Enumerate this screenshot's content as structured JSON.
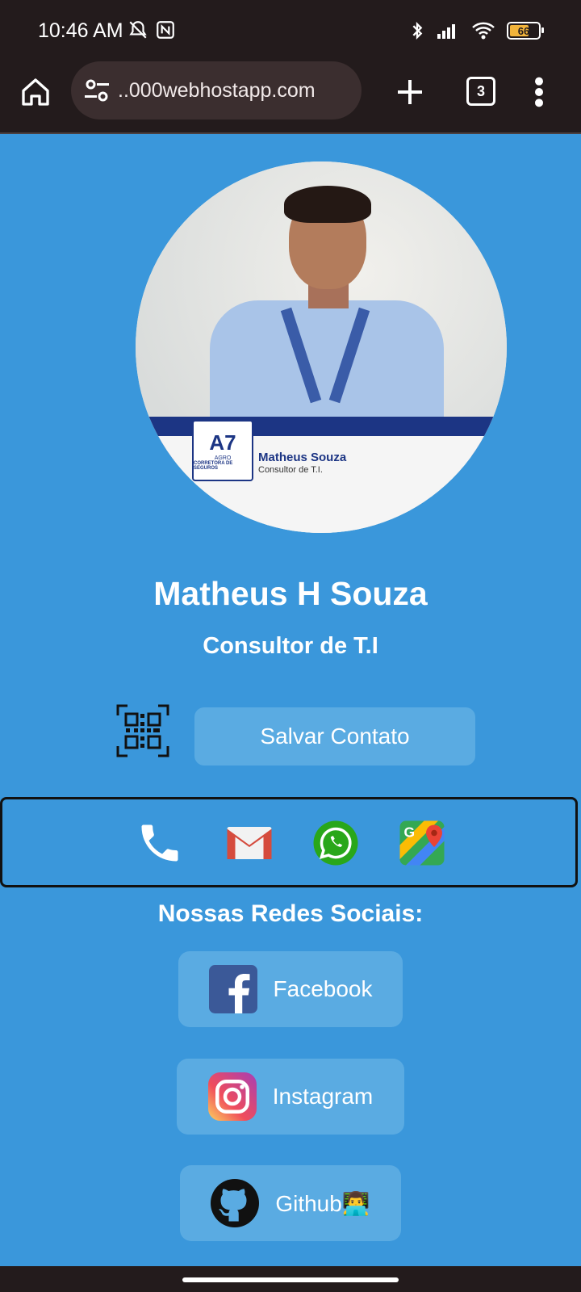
{
  "status_bar": {
    "time": "10:46 AM",
    "battery": "66"
  },
  "browser": {
    "url": "..000webhostapp.com",
    "tab_count": "3"
  },
  "profile": {
    "photo_badge_name": "Matheus Souza",
    "photo_badge_role": "Consultor de T.I.",
    "photo_logo_text": "A7",
    "photo_logo_sub": "AGRO",
    "photo_logo_corr": "CORRETORA DE SEGUROS",
    "name": "Matheus H Souza",
    "role": "Consultor de T.I"
  },
  "actions": {
    "save_contact_label": "Salvar Contato"
  },
  "contact_icons": [
    "phone-icon",
    "gmail-icon",
    "whatsapp-icon",
    "google-maps-icon"
  ],
  "social": {
    "title": "Nossas Redes Sociais:",
    "items": [
      {
        "label": "Facebook",
        "icon": "facebook-icon"
      },
      {
        "label": "Instagram",
        "icon": "instagram-icon"
      },
      {
        "label": "Github👨‍💻",
        "icon": "github-icon"
      }
    ]
  },
  "colors": {
    "page_bg": "#3a97db",
    "button_bg": "#5aabe2",
    "system_bar": "#231b1c"
  }
}
